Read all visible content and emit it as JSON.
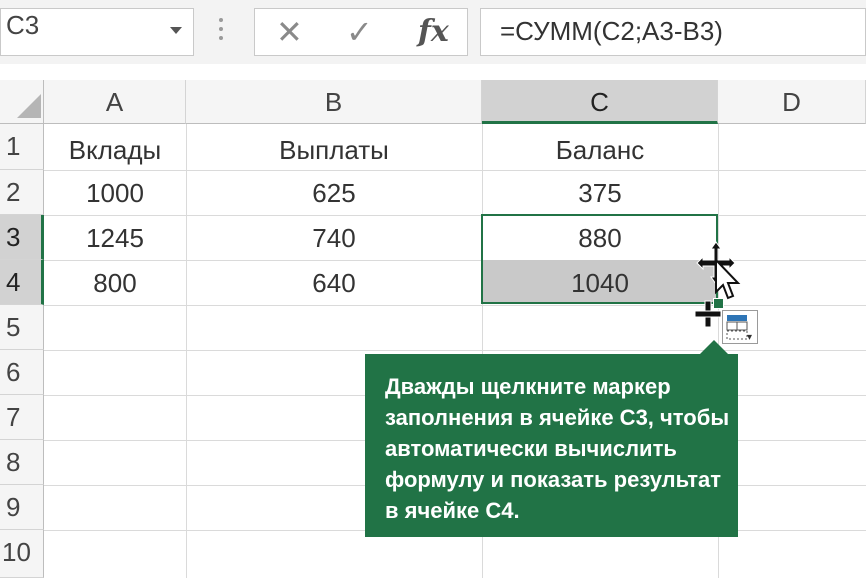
{
  "formula_bar": {
    "name_box": "C3",
    "formula": "=СУММ(C2;A3-B3)",
    "cancel_icon": "close-icon",
    "enter_icon": "check-icon",
    "function_icon": "fx-icon"
  },
  "columns": [
    "A",
    "B",
    "C",
    "D"
  ],
  "rows": [
    "1",
    "2",
    "3",
    "4",
    "5",
    "6",
    "7",
    "8",
    "9",
    "10"
  ],
  "cells": {
    "A1": "Вклады",
    "B1": "Выплаты",
    "C1": "Баланс",
    "A2": "1000",
    "B2": "625",
    "C2": "375",
    "A3": "1245",
    "B3": "740",
    "C3": "880",
    "A4": "800",
    "B4": "640",
    "C4": "1040"
  },
  "tooltip": {
    "text": "Дважды щелкните маркер заполнения в ячейке C3, чтобы автоматически вычислить формулу и показать результат в ячейке C4."
  },
  "colors": {
    "accent": "#217346",
    "selected_header": "#d2d2d2",
    "filled_cell": "#c9c9c9"
  }
}
